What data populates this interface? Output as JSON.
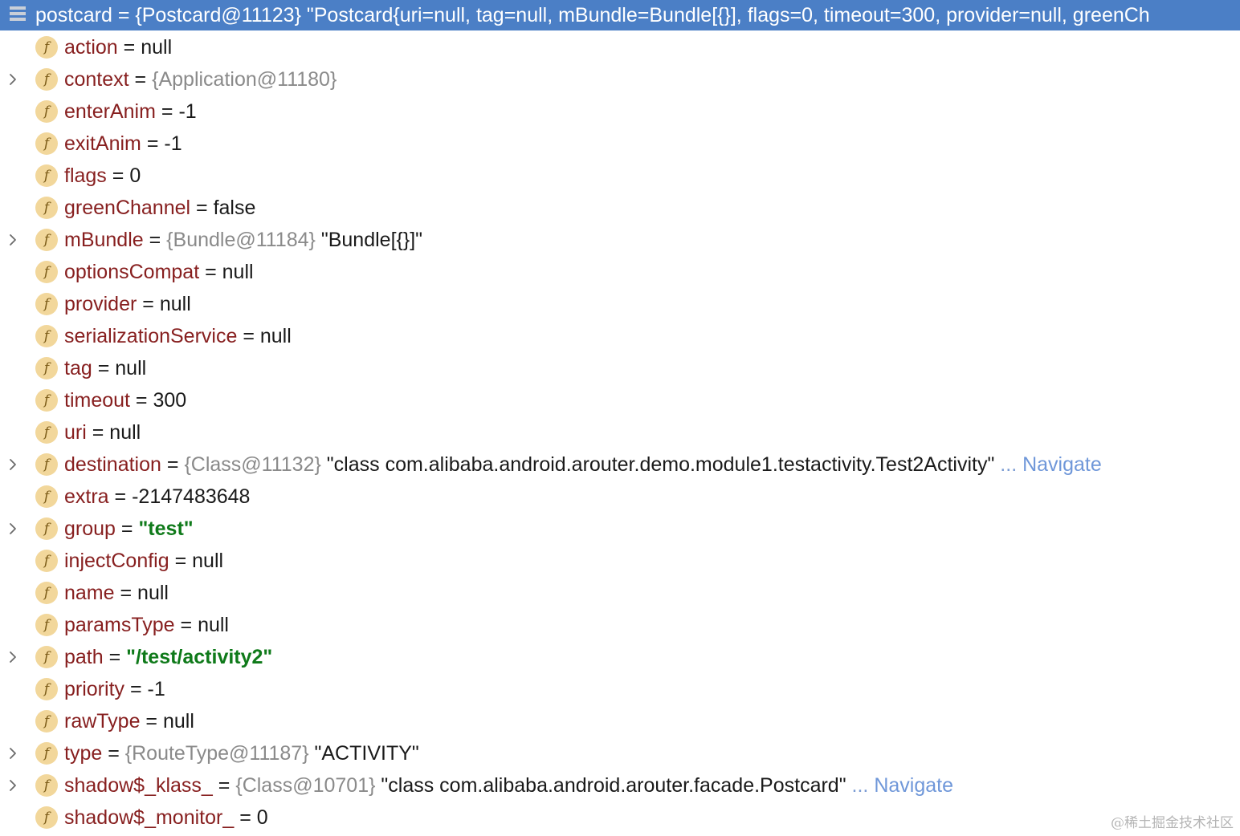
{
  "header": {
    "text": "postcard = {Postcard@11123} \"Postcard{uri=null, tag=null, mBundle=Bundle[{}], flags=0, timeout=300, provider=null, greenCh"
  },
  "field_icon_letter": "f",
  "rows": [
    {
      "name": "action",
      "eq": " = ",
      "value": "null"
    },
    {
      "name": "context",
      "eq": " = ",
      "ref": "{Application@11180}"
    },
    {
      "name": "enterAnim",
      "eq": " = ",
      "value": "-1"
    },
    {
      "name": "exitAnim",
      "eq": " = ",
      "value": "-1"
    },
    {
      "name": "flags",
      "eq": " = ",
      "value": "0"
    },
    {
      "name": "greenChannel",
      "eq": " = ",
      "value": "false"
    },
    {
      "name": "mBundle",
      "eq": " = ",
      "ref": "{Bundle@11184}",
      "value": " \"Bundle[{}]\""
    },
    {
      "name": "optionsCompat",
      "eq": " = ",
      "value": "null"
    },
    {
      "name": "provider",
      "eq": " = ",
      "value": "null"
    },
    {
      "name": "serializationService",
      "eq": " = ",
      "value": "null"
    },
    {
      "name": "tag",
      "eq": " = ",
      "value": "null"
    },
    {
      "name": "timeout",
      "eq": " = ",
      "value": "300"
    },
    {
      "name": "uri",
      "eq": " = ",
      "value": "null"
    },
    {
      "name": "destination",
      "eq": " = ",
      "ref": "{Class@11132}",
      "value": " \"class com.alibaba.android.arouter.demo.module1.testactivity.Test2Activity\"",
      "ellipsis": " ... ",
      "link": "Navigate"
    },
    {
      "name": "extra",
      "eq": " = ",
      "value": "-2147483648"
    },
    {
      "name": "group",
      "eq": " = ",
      "str": "\"test\""
    },
    {
      "name": "injectConfig",
      "eq": " = ",
      "value": "null"
    },
    {
      "name": "name",
      "eq": " = ",
      "value": "null"
    },
    {
      "name": "paramsType",
      "eq": " = ",
      "value": "null"
    },
    {
      "name": "path",
      "eq": " = ",
      "str": "\"/test/activity2\""
    },
    {
      "name": "priority",
      "eq": " = ",
      "value": "-1"
    },
    {
      "name": "rawType",
      "eq": " = ",
      "value": "null"
    },
    {
      "name": "type",
      "eq": " = ",
      "ref": "{RouteType@11187}",
      "value": " \"ACTIVITY\""
    },
    {
      "name": "shadow$_klass_",
      "eq": " = ",
      "ref": "{Class@10701}",
      "value": " \"class com.alibaba.android.arouter.facade.Postcard\"",
      "ellipsis": " ... ",
      "link": "Navigate"
    },
    {
      "name": "shadow$_monitor_",
      "eq": " = ",
      "value": "0"
    }
  ],
  "expandable_rows": [
    1,
    6,
    13,
    15,
    19,
    22,
    23
  ],
  "watermark": "@稀土掘金技术社区",
  "colors": {
    "header_bg": "#4b7fc6",
    "field_name": "#871f1f",
    "reference": "#8a8a8a",
    "string_value": "#0f7a1a",
    "navigate_link": "#6f97d9",
    "field_icon_bg": "#f2d79b"
  },
  "icons": {
    "header": "object-icon",
    "field": "field-icon",
    "expand": "chevron-right-icon"
  }
}
